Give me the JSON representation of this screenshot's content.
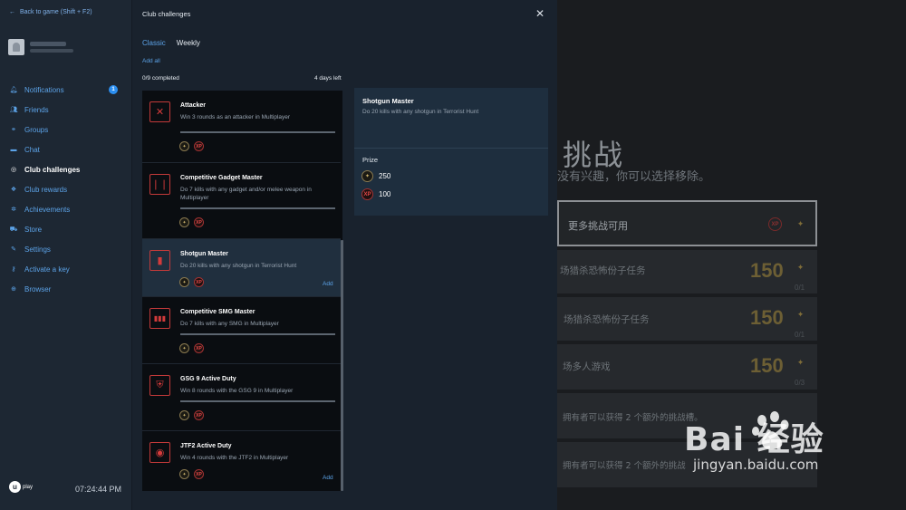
{
  "sidebar": {
    "back_label": "Back to game (Shift + F2)",
    "items": [
      {
        "label": "Notifications",
        "icon": "bell-icon",
        "badge": "1"
      },
      {
        "label": "Friends",
        "icon": "friends-icon"
      },
      {
        "label": "Groups",
        "icon": "groups-icon"
      },
      {
        "label": "Chat",
        "icon": "chat-icon"
      },
      {
        "label": "Club challenges",
        "icon": "challenges-icon",
        "active": true
      },
      {
        "label": "Club rewards",
        "icon": "rewards-icon"
      },
      {
        "label": "Achievements",
        "icon": "achievements-icon"
      },
      {
        "label": "Store",
        "icon": "cart-icon"
      },
      {
        "label": "Settings",
        "icon": "wrench-icon"
      },
      {
        "label": "Activate a key",
        "icon": "key-icon"
      },
      {
        "label": "Browser",
        "icon": "globe-icon"
      }
    ],
    "logo_text": "play",
    "clock": "07:24:44 PM"
  },
  "panel": {
    "title": "Club challenges",
    "tabs": [
      "Classic",
      "Weekly"
    ],
    "add_all": "Add all",
    "completed": "0/9 completed",
    "days_left": "4 days left"
  },
  "challenges": [
    {
      "title": "Attacker",
      "desc": "Win 3 rounds as an attacker in Multiplayer",
      "icon": "cross-icon",
      "glyph": "✕",
      "add": ""
    },
    {
      "title": "Competitive Gadget Master",
      "desc": "Do 7 kills with any gadget and/or melee weapon in Multiplayer",
      "icon": "gadget-icon",
      "glyph": "❘❘",
      "add": ""
    },
    {
      "title": "Shotgun Master",
      "desc": "Do 20 kills with any shotgun in Terrorist Hunt",
      "icon": "shotgun-icon",
      "glyph": "▮",
      "add": "Add"
    },
    {
      "title": "Competitive SMG Master",
      "desc": "Do 7 kills with any SMG in Multiplayer",
      "icon": "smg-icon",
      "glyph": "▮▮▮",
      "add": ""
    },
    {
      "title": "GSG 9 Active Duty",
      "desc": "Win 8 rounds with the GSG 9 in Multiplayer",
      "icon": "gsg9-icon",
      "glyph": "⛨",
      "add": ""
    },
    {
      "title": "JTF2 Active Duty",
      "desc": "Win 4 rounds with the JTF2 in Multiplayer",
      "icon": "jtf2-icon",
      "glyph": "◉",
      "add": "Add"
    }
  ],
  "detail": {
    "title": "Shotgun Master",
    "desc": "Do 20 kills with any shotgun in Terrorist Hunt",
    "prize_label": "Prize",
    "prizes": [
      {
        "icon": "renown-icon",
        "glyph": "✦",
        "value": "250"
      },
      {
        "icon": "xp-icon",
        "glyph": "XP",
        "value": "100"
      }
    ]
  },
  "game": {
    "title": "挑战",
    "subtitle": "没有兴趣，你可以选择移除。",
    "rows": [
      {
        "text": "更多挑战可用",
        "num": "",
        "count": ""
      },
      {
        "text": "场猎杀恐怖份子任务",
        "num": "150",
        "count": "0/1"
      },
      {
        "text": "场猎杀恐怖份子任务",
        "num": "150",
        "count": "0/1"
      },
      {
        "text": "场多人游戏",
        "num": "150",
        "count": "0/3"
      },
      {
        "text": "拥有者可以获得 2 个额外的挑战槽。",
        "num": "",
        "count": ""
      },
      {
        "text": "拥有者可以获得 2 个额外的挑战",
        "num": "",
        "count": ""
      }
    ]
  },
  "watermark": {
    "main": "Bai  经验",
    "url": "jingyan.baidu.com"
  },
  "colors": {
    "accent": "#5ca3e8",
    "challenge_red": "#d43b3b",
    "sidebar_bg": "#1d2733",
    "panel_bg": "#19222d"
  }
}
